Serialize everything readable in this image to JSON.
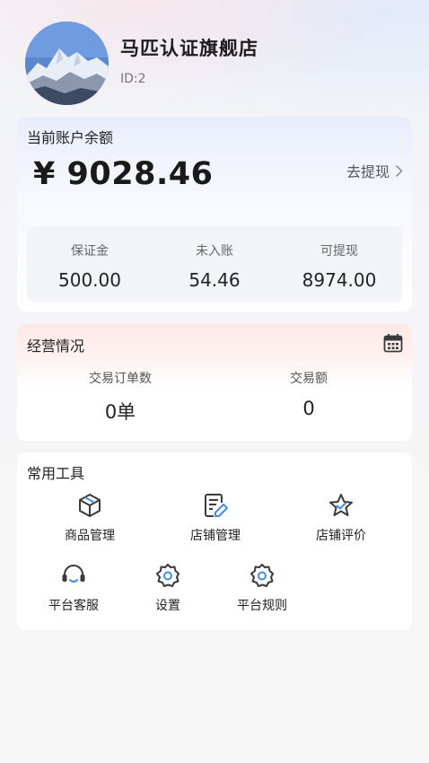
{
  "header": {
    "store_name": "马匹认证旗舰店",
    "store_id": "ID:2"
  },
  "balance": {
    "title": "当前账户余额",
    "amount": "¥ 9028.46",
    "withdraw_label": "去提现",
    "stats": [
      {
        "label": "保证金",
        "value": "500.00"
      },
      {
        "label": "未入账",
        "value": "54.46"
      },
      {
        "label": "可提现",
        "value": "8974.00"
      }
    ]
  },
  "operations": {
    "title": "经营情况",
    "stats": [
      {
        "label": "交易订单数",
        "value": "0单"
      },
      {
        "label": "交易额",
        "value": "0"
      }
    ]
  },
  "tools": {
    "title": "常用工具",
    "items": [
      {
        "label": "商品管理",
        "icon": "box-icon"
      },
      {
        "label": "店铺管理",
        "icon": "document-edit-icon"
      },
      {
        "label": "店铺评价",
        "icon": "star-icon"
      },
      {
        "label": "平台客服",
        "icon": "headset-icon"
      },
      {
        "label": "设置",
        "icon": "gear-icon"
      },
      {
        "label": "平台规则",
        "icon": "gear-icon"
      }
    ]
  },
  "colors": {
    "icon_stroke": "#3a3a3a",
    "icon_accent": "#3d8ef0"
  }
}
